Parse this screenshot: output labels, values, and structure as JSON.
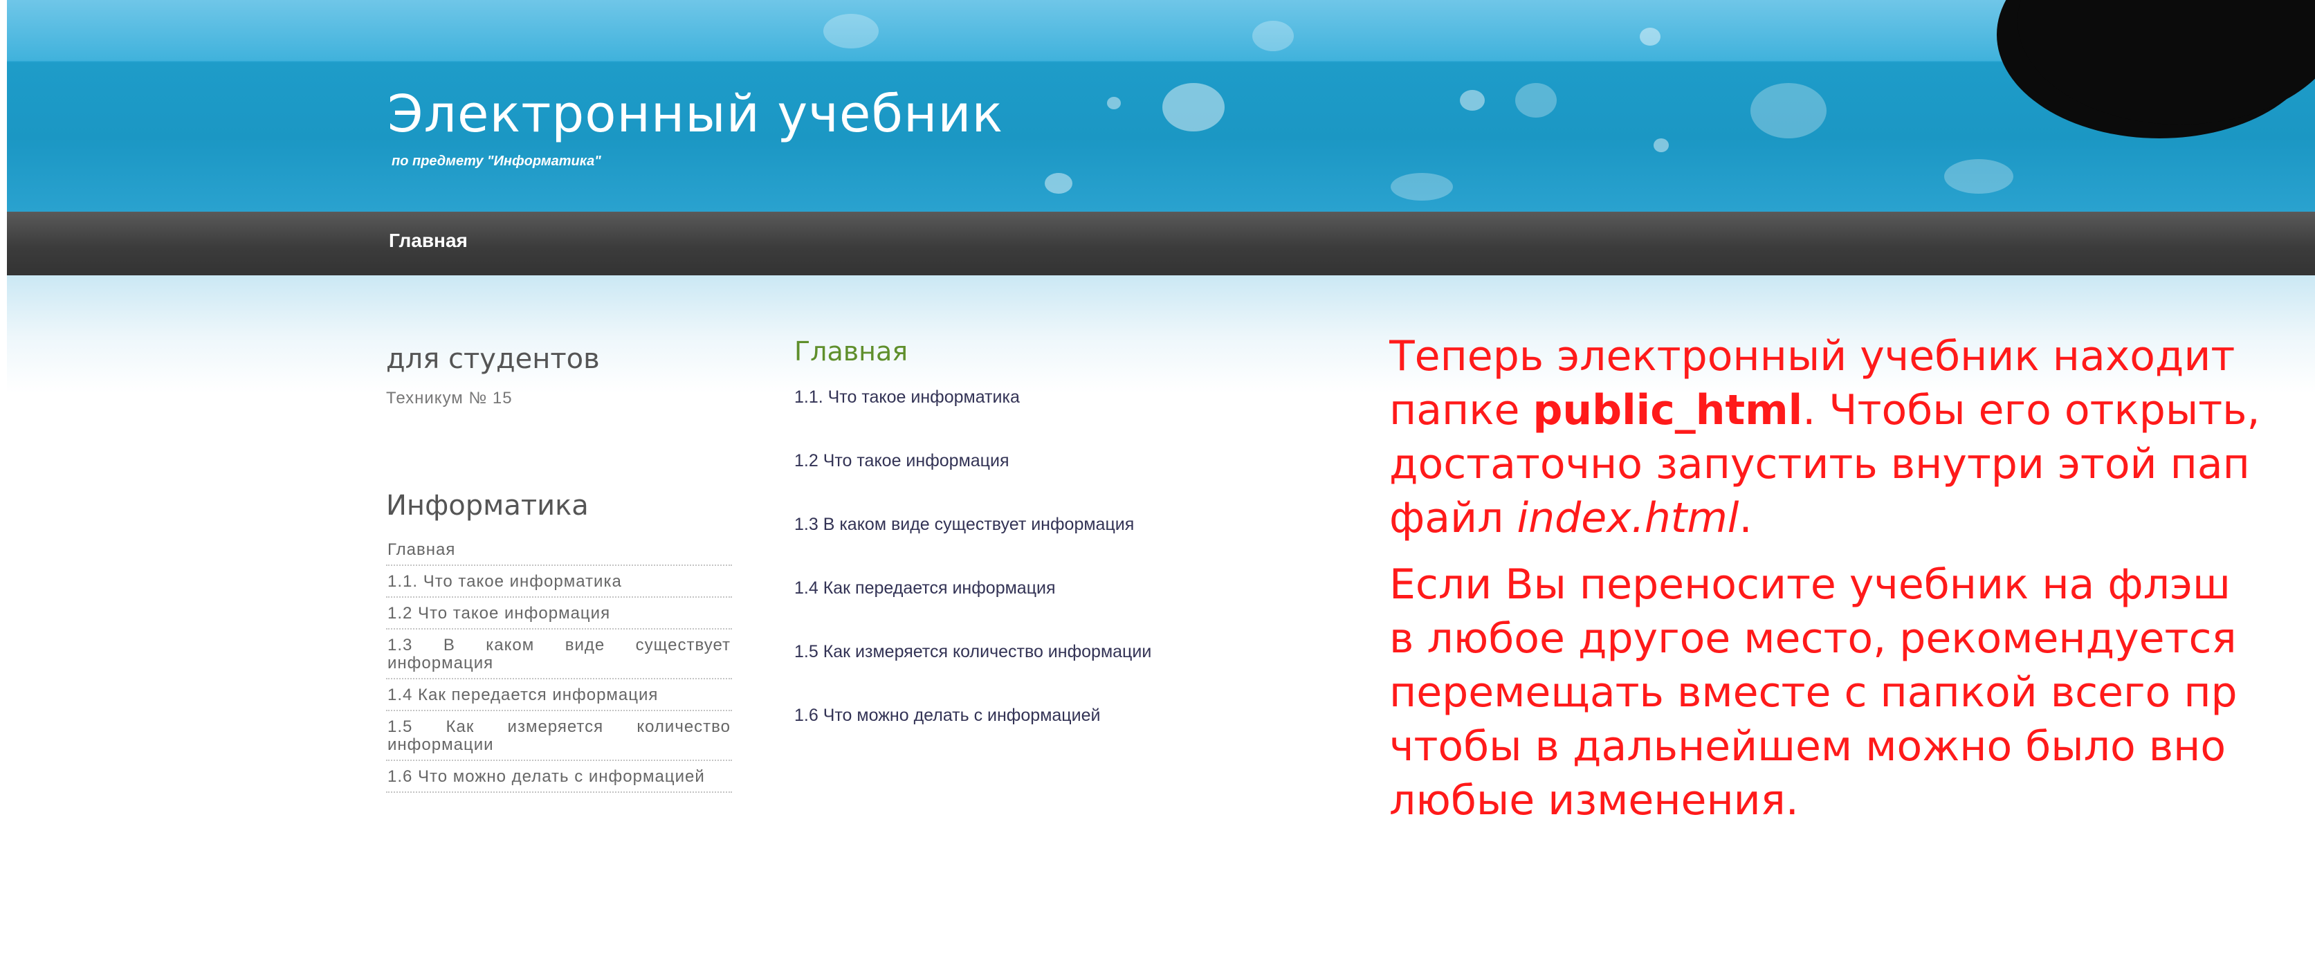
{
  "header": {
    "title": "Электронный учебник",
    "subtitle": "по предмету \"Информатика\""
  },
  "nav": {
    "home": "Главная"
  },
  "sidebar": {
    "heading1": "для студентов",
    "text1": "Техникум № 15",
    "heading2": "Информатика",
    "items": [
      "Главная",
      "1.1. Что такое информатика",
      "1.2 Что такое информация",
      "1.3 В каком виде существует информация",
      "1.4 Как передается информация",
      "1.5 Как измеряется количество информации",
      "1.6 Что можно делать с информацией"
    ]
  },
  "main": {
    "heading": "Главная",
    "links": [
      "1.1. Что такое информатика",
      "1.2 Что такое информация",
      "1.3 В каком виде существует информация",
      "1.4 Как передается информация",
      "1.5 Как измеряется количество информации",
      "1.6 Что можно делать с информацией"
    ]
  },
  "instructions": {
    "p1_part1": "Теперь электронный учебник находит",
    "p1_part2": "папке ",
    "p1_bold": "public_html",
    "p1_part3": ". Чтобы его открыть,",
    "p1_part4": "достаточно запустить внутри этой пап",
    "p1_part5": "файл ",
    "p1_italic": "index.html",
    "p1_part6": ".",
    "p2_line1": "Если Вы переносите учебник на флэш",
    "p2_line2": "в любое другое место, рекомендуется",
    "p2_line3": "перемещать вместе с папкой всего пр",
    "p2_line4": "чтобы в дальнейшем можно было вно",
    "p2_line5": "любые изменения."
  },
  "colors": {
    "header_blue": "#1b97c4",
    "nav_dark": "#3c3c3c",
    "instruction_red": "#ff1a1a",
    "green_heading": "#5f8f2c"
  }
}
